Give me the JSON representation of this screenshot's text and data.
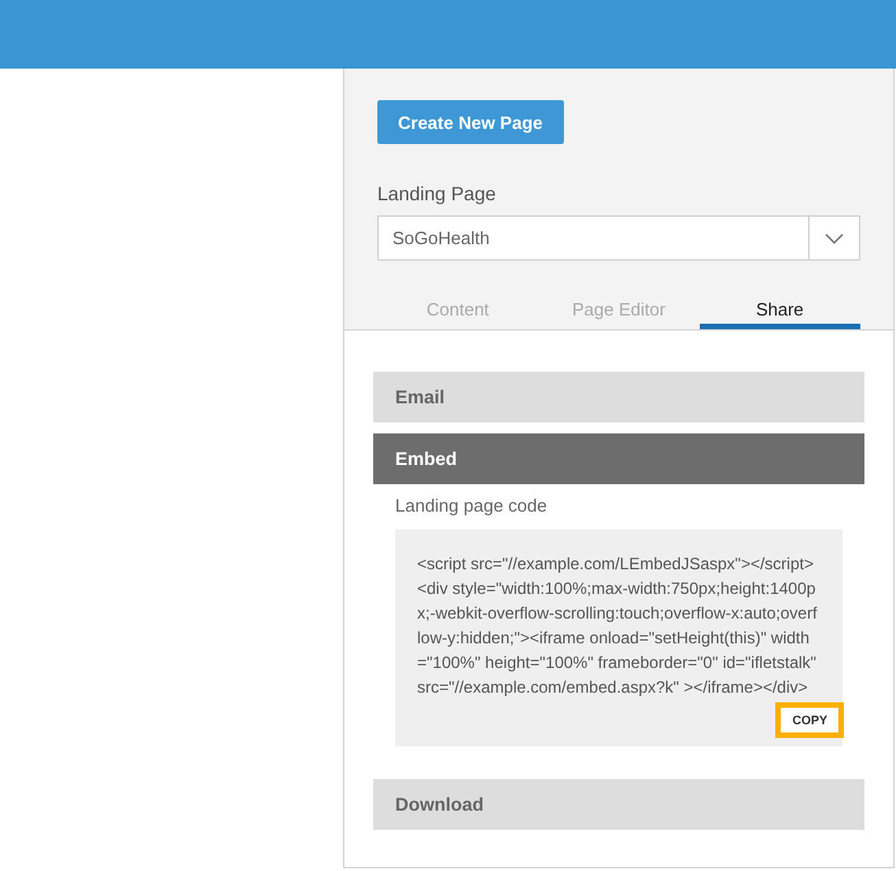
{
  "create_button": "Create New Page",
  "landing_page": {
    "label": "Landing Page",
    "value": "SoGoHealth"
  },
  "tabs": [
    {
      "label": "Content",
      "selected": false
    },
    {
      "label": "Page Editor",
      "selected": false
    },
    {
      "label": "Share",
      "selected": true
    }
  ],
  "sections": [
    {
      "title": "Email",
      "expanded": false
    },
    {
      "title": "Embed",
      "expanded": true,
      "code_label": "Landing page code",
      "code": "<script src=\"//example.com/LEmbedJSaspx\"></script><div style=\"width:100%;max-width:750px;height:1400px;-webkit-overflow-scrolling:touch;overflow-x:auto;overflow-y:hidden;\"><iframe onload=\"setHeight(this)\" width=\"100%\" height=\"100%\" frameborder=\"0\" id=\"ifletstalk\" src=\"//example.com/embed.aspx?k\" ></iframe></div>",
      "copy_button": "COPY"
    },
    {
      "title": "Download",
      "expanded": false
    }
  ]
}
